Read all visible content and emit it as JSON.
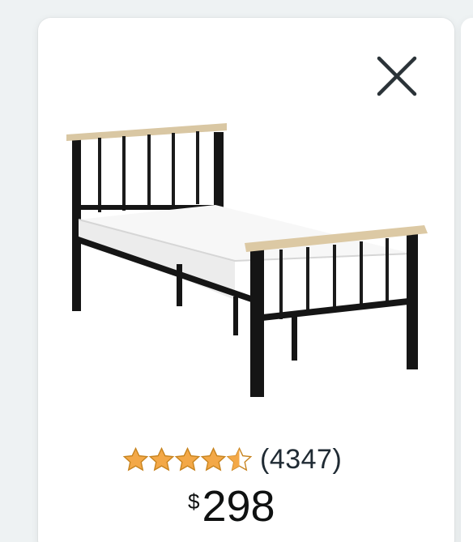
{
  "product": {
    "image_icon": "metal-bed-frame-image",
    "rating": 4.5,
    "rating_max": 5,
    "review_count": "(4347)",
    "price_symbol": "$",
    "price_whole": "298"
  },
  "actions": {
    "close_icon": "close-icon"
  },
  "colors": {
    "star": "#f3a847",
    "star_outline": "#c7831e",
    "text": "#1f2a33",
    "background": "#eef2f3",
    "card": "#ffffff"
  }
}
